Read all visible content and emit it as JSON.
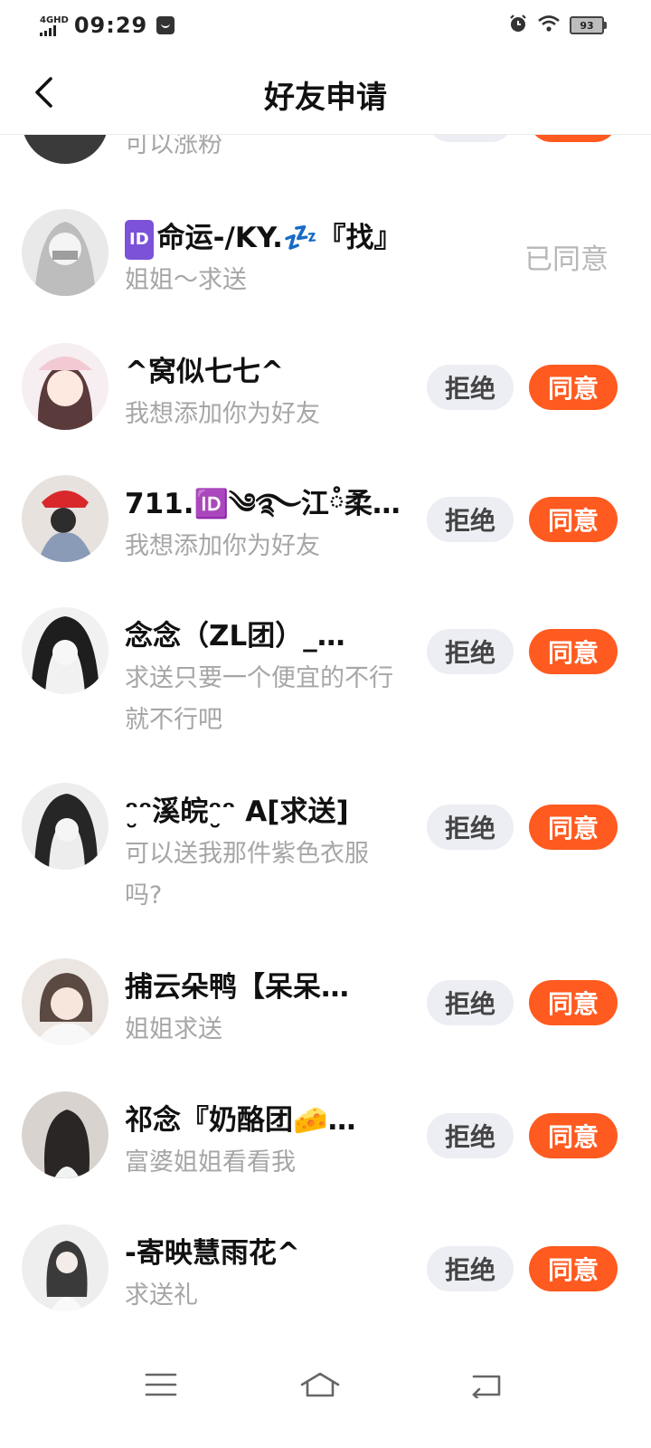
{
  "status_bar": {
    "network": "4GHD",
    "time": "09:29",
    "battery": "93",
    "icons": [
      "signal-icon",
      "message-icon",
      "alarm-icon",
      "wifi-icon",
      "battery-icon"
    ]
  },
  "nav": {
    "title": "好友申请",
    "back_icon": "chevron-left-icon"
  },
  "buttons": {
    "reject": "拒绝",
    "accept": "同意",
    "agreed": "已同意"
  },
  "requests": [
    {
      "name": "",
      "message": "可以涨粉",
      "status": "pending",
      "partial": true
    },
    {
      "name": "命运-/KY.💤『找』",
      "id_badge": "ID",
      "message": "姐姐～求送",
      "status": "agreed"
    },
    {
      "name": "^窝似七七^",
      "message": "我想添加你为好友",
      "status": "pending"
    },
    {
      "name": "711.🆔༄࿐江ཾ柔…",
      "message": "我想添加你为好友",
      "status": "pending"
    },
    {
      "name": "念念（ZL团）_…",
      "message": "求送只要一个便宜的不行就不行吧",
      "status": "pending"
    },
    {
      "name": "ᵔ̮ᵔ溪皖ᵔ̮ᵔ A[求送]",
      "message": "可以送我那件紫色衣服吗?",
      "status": "pending"
    },
    {
      "name": "捕云朵鸭【呆呆…",
      "message": "姐姐求送",
      "status": "pending"
    },
    {
      "name": "祁念『奶酪团🧀…",
      "message": "富婆姐姐看看我",
      "status": "pending"
    },
    {
      "name": "-寄映慧雨花^",
      "message": "求送礼",
      "status": "pending"
    }
  ],
  "system_nav": {
    "icons": [
      "menu-icon",
      "home-icon",
      "back-icon"
    ]
  },
  "colors": {
    "accent": "#ff5a1f",
    "reject_bg": "#eceef3",
    "muted_text": "#a6a6a6",
    "id_badge": "#7b52d8"
  }
}
